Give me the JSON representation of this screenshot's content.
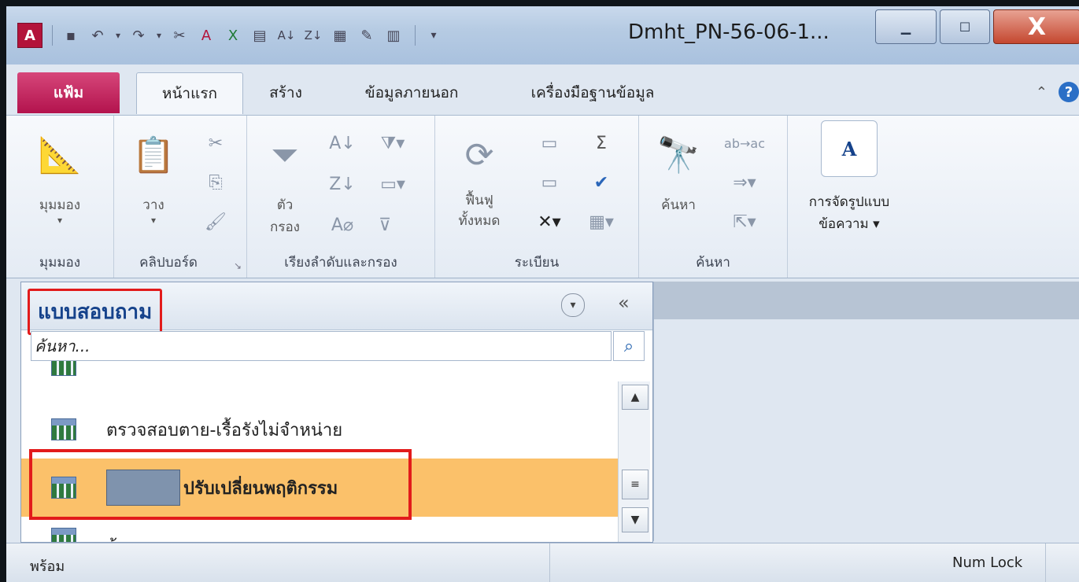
{
  "window": {
    "title": "Dmht_PN-56-06-1...",
    "minimize": "▁",
    "maximize": "☐",
    "close": "X"
  },
  "qat": {
    "icons": [
      "access-logo-icon",
      "save-icon",
      "undo-icon",
      "redo-icon",
      "cut-icon",
      "import-access-icon",
      "import-excel-icon",
      "form-icon",
      "sort-asc-icon",
      "sort-desc-icon",
      "table-icon",
      "design-icon",
      "datasheet-icon",
      "customize-qat-icon"
    ]
  },
  "tabs": {
    "file": "แฟ้ม",
    "home": "หน้าแรก",
    "create": "สร้าง",
    "external": "ข้อมูลภายนอก",
    "dbtools": "เครื่องมือฐานข้อมูล"
  },
  "ribbon": {
    "views": {
      "button": "มุมมอง",
      "group": "มุมมอง"
    },
    "clipboard": {
      "paste": "วาง",
      "group": "คลิปบอร์ด"
    },
    "sortfilter": {
      "filter_line1": "ตัว",
      "filter_line2": "กรอง",
      "group": "เรียงลำดับและกรอง"
    },
    "records": {
      "refresh_line1": "ฟื้นฟู",
      "refresh_line2": "ทั้งหมด",
      "group": "ระเบียน"
    },
    "find": {
      "find": "ค้นหา",
      "group": "ค้นหา"
    },
    "format": {
      "line1": "การจัดรูปแบบ",
      "line2": "ข้อความ ▾"
    }
  },
  "navpane": {
    "title": "แบบสอบถาม",
    "search_placeholder": "ค้นหา...",
    "items": [
      {
        "label": "ตรวจสอบตาย-เรื้อรังไม่จำหน่าย"
      },
      {
        "label": "ปรับเปลี่ยนพฤติกรรม"
      },
      {
        "label": "บ้าน"
      }
    ]
  },
  "status": {
    "ready": "พร้อม",
    "numlock": "Num Lock"
  },
  "colors": {
    "file_tab": "#b3134d",
    "selection": "#fbc16a",
    "highlight_box": "#e21b1b",
    "nav_title": "#15428b"
  }
}
